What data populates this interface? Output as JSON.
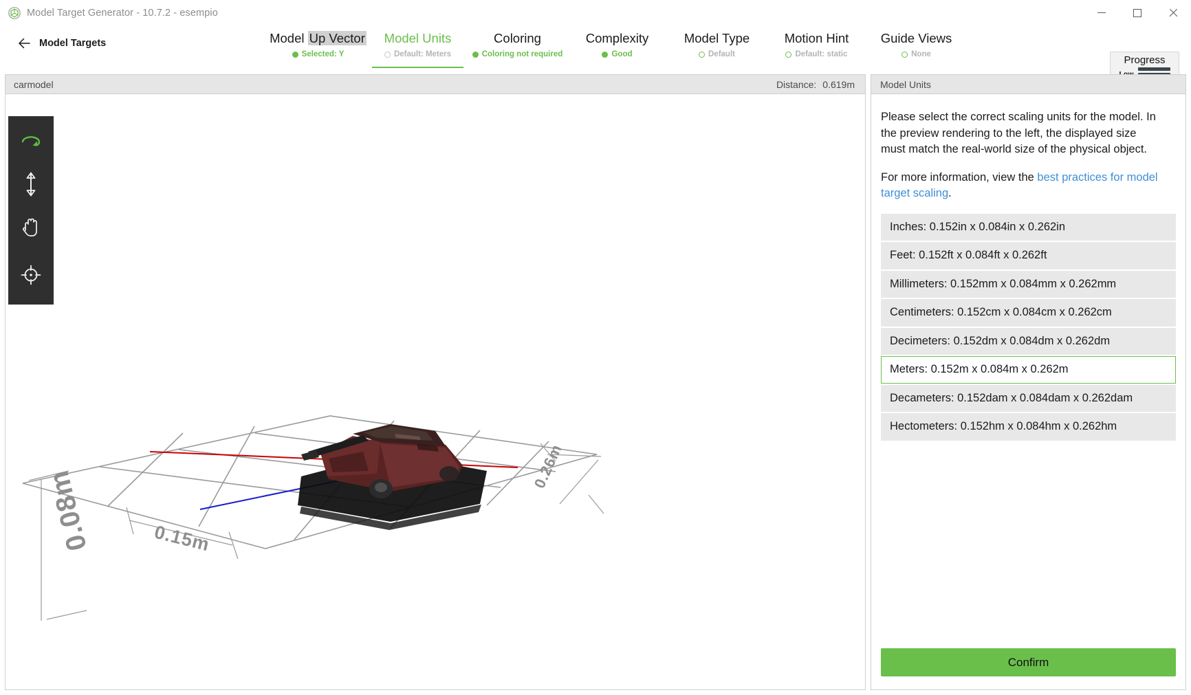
{
  "window": {
    "title": "Model Target Generator - 10.7.2 - esempio",
    "app_icon": "cube-icon",
    "minimize_label": "Minimize",
    "maximize_label": "Maximize",
    "close_label": "Close"
  },
  "nav": {
    "back_label": "Model Targets",
    "back_icon": "arrow-left-icon",
    "steps": [
      {
        "title_plain": "Model ",
        "title_highlight": "Up Vector",
        "sub": "Selected: Y",
        "state": "done",
        "active": false
      },
      {
        "title_plain": "Model Units",
        "title_highlight": "",
        "sub": "Default: Meters",
        "state": "pending-grey",
        "active": true
      },
      {
        "title_plain": "Coloring",
        "title_highlight": "",
        "sub": "Coloring not required",
        "state": "done",
        "active": false
      },
      {
        "title_plain": "Complexity",
        "title_highlight": "",
        "sub": "Good",
        "state": "done",
        "active": false
      },
      {
        "title_plain": "Model Type",
        "title_highlight": "",
        "sub": "Default",
        "state": "pending-green",
        "active": false
      },
      {
        "title_plain": "Motion Hint",
        "title_highlight": "",
        "sub": "Default: static",
        "state": "pending-green",
        "active": false
      },
      {
        "title_plain": "Guide Views",
        "title_highlight": "",
        "sub": "None",
        "state": "pending-green",
        "active": false
      }
    ],
    "progress": {
      "title": "Progress",
      "level_label": "Low",
      "bar_colors": [
        "#3c464b",
        "#3c464b",
        "#e8000d"
      ]
    }
  },
  "viewport": {
    "model_name": "carmodel",
    "distance_label": "Distance:",
    "distance_value": "0.619m",
    "tools": [
      {
        "name": "orbit-rotate-tool",
        "label": "Rotate",
        "active": true
      },
      {
        "name": "zoom-tool",
        "label": "Zoom",
        "active": false
      },
      {
        "name": "pan-hand-tool",
        "label": "Pan",
        "active": false
      },
      {
        "name": "focus-target-tool",
        "label": "Focus",
        "active": false
      }
    ],
    "dimension_labels": {
      "height": "0.08m",
      "width": "0.15m",
      "depth": "0.26m"
    },
    "axis_colors": {
      "x": "#cc0000",
      "z": "#0000cc",
      "grid": "#9a9a9a"
    },
    "model_color": "#6b2b2b"
  },
  "side_panel": {
    "header_title": "Model Units",
    "description_line1": "Please select the correct scaling units for the model. In",
    "description_line2": "the preview rendering to the left, the displayed size",
    "description_line3": "must match the real-world size of the physical object.",
    "info_prefix": "For more information, view the ",
    "info_link_line1": "best practices for model",
    "info_link_line2": "target scaling",
    "info_suffix": ".",
    "units": [
      {
        "label": "Inches: 0.152in x 0.084in x 0.262in",
        "selected": false
      },
      {
        "label": "Feet: 0.152ft x 0.084ft x 0.262ft",
        "selected": false
      },
      {
        "label": "Millimeters: 0.152mm x 0.084mm x 0.262mm",
        "selected": false
      },
      {
        "label": "Centimeters: 0.152cm x 0.084cm x 0.262cm",
        "selected": false
      },
      {
        "label": "Decimeters: 0.152dm x 0.084dm x 0.262dm",
        "selected": false
      },
      {
        "label": "Meters: 0.152m x 0.084m x 0.262m",
        "selected": true
      },
      {
        "label": "Decameters: 0.152dam x 0.084dam x 0.262dam",
        "selected": false
      },
      {
        "label": "Hectometers: 0.152hm x 0.084hm x 0.262hm",
        "selected": false
      }
    ],
    "confirm_label": "Confirm"
  },
  "colors": {
    "accent_green": "#6abf4b",
    "link_blue": "#3f8fd8",
    "panel_header": "#e6e6e6",
    "list_row": "#e8e8e8",
    "toolbar_dark": "#2f2f2f"
  }
}
